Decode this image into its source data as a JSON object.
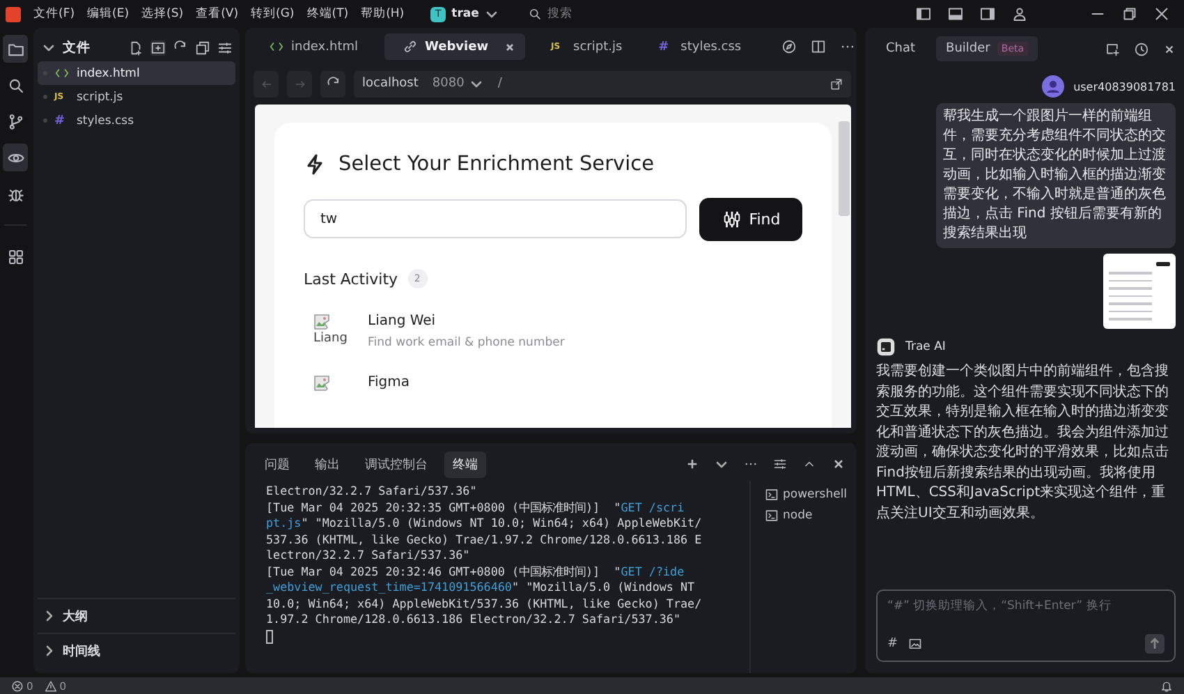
{
  "menu_bar": {
    "menu_items": [
      "文件(F)",
      "编辑(E)",
      "选择(S)",
      "查看(V)",
      "转到(G)",
      "终端(T)",
      "帮助(H)"
    ],
    "project": {
      "initial": "T",
      "name": "trae"
    },
    "search": {
      "placeholder": "搜索"
    }
  },
  "activity_bar": {
    "items": [
      {
        "kind": "files",
        "selected": true
      },
      {
        "kind": "search",
        "selected": false
      },
      {
        "kind": "branch",
        "selected": false
      },
      {
        "kind": "preview",
        "selected": true
      },
      {
        "kind": "bug",
        "selected": false
      },
      {
        "kind": "grid",
        "selected": false
      }
    ]
  },
  "explorer": {
    "title": "文件",
    "expanded": true,
    "files": [
      {
        "name": "index.html",
        "kind": "html",
        "selected": true
      },
      {
        "name": "script.js",
        "kind": "js",
        "icon": "JS",
        "selected": false
      },
      {
        "name": "styles.css",
        "kind": "css",
        "icon": "#",
        "selected": false
      }
    ],
    "sections": [
      {
        "title": "大纲",
        "expanded": false
      },
      {
        "title": "时间线",
        "expanded": false
      }
    ]
  },
  "editor": {
    "tabs": [
      {
        "label": "index.html",
        "kind": "html",
        "selected": false,
        "closable": false
      },
      {
        "label": "Webview",
        "kind": "webview",
        "selected": true,
        "closable": true
      },
      {
        "label": "script.js",
        "kind": "js",
        "icon": "JS",
        "selected": false,
        "closable": false
      },
      {
        "label": "styles.css",
        "kind": "css",
        "icon": "#",
        "selected": false,
        "closable": false
      }
    ],
    "address": {
      "host": "localhost",
      "port": "8080",
      "path": "/"
    },
    "webview": {
      "title": "Select Your Enrichment Service",
      "search": {
        "value": "tw"
      },
      "button": "Find",
      "activity": {
        "title": "Last Activity",
        "count": "2",
        "items": [
          {
            "alt": "Liang",
            "name": "Liang Wei",
            "description": "Find work email & phone number"
          },
          {
            "name": "Figma"
          }
        ]
      }
    }
  },
  "panel": {
    "tabs": [
      {
        "label": "问题",
        "selected": false
      },
      {
        "label": "输出",
        "selected": false
      },
      {
        "label": "调试控制台",
        "selected": false
      },
      {
        "label": "终端",
        "selected": true
      }
    ],
    "lines": [
      [
        {
          "kind": "plain",
          "text": "Electron/32.2.7 Safari/537.36\""
        }
      ],
      [
        {
          "kind": "plain",
          "text": "[Tue Mar 04 2025 20:32:35 GMT+0800 (中国标准时间)]  \""
        },
        {
          "kind": "request",
          "text": "GET /scri"
        }
      ],
      [
        {
          "kind": "request",
          "text": "pt.js"
        },
        {
          "kind": "plain",
          "text": "\" \"Mozilla/5.0 (Windows NT 10.0; Win64; x64) AppleWebKit/"
        }
      ],
      [
        {
          "kind": "plain",
          "text": "537.36 (KHTML, like Gecko) Trae/1.97.2 Chrome/128.0.6613.186 E"
        }
      ],
      [
        {
          "kind": "plain",
          "text": "lectron/32.2.7 Safari/537.36\""
        }
      ],
      [
        {
          "kind": "plain",
          "text": "[Tue Mar 04 2025 20:32:46 GMT+0800 (中国标准时间)]  \""
        },
        {
          "kind": "request",
          "text": "GET /?ide"
        }
      ],
      [
        {
          "kind": "request",
          "text": "_webview_request_time=1741091566460"
        },
        {
          "kind": "plain",
          "text": "\" \"Mozilla/5.0 (Windows NT"
        }
      ],
      [
        {
          "kind": "plain",
          "text": "10.0; Win64; x64) AppleWebKit/537.36 (KHTML, like Gecko) Trae/"
        }
      ],
      [
        {
          "kind": "plain",
          "text": "1.97.2 Chrome/128.0.6613.186 Electron/32.2.7 Safari/537.36\""
        }
      ]
    ],
    "terminals": [
      {
        "name": "powershell"
      },
      {
        "name": "node"
      }
    ]
  },
  "chat": {
    "tabs": [
      {
        "label": "Chat",
        "selected": false
      },
      {
        "label": "Builder",
        "badge": "Beta",
        "selected": true
      }
    ],
    "messages": [
      {
        "kind": "user",
        "author": "user40839081781",
        "text": "帮我生成一个跟图片一样的前端组件，需要充分考虑组件不同状态的交互，同时在状态变化的时候加上过渡动画，比如输入时输入框的描边渐变需要变化，不输入时就是普通的灰色描边，点击 Find 按钮后需要有新的搜索结果出现",
        "attachment": true
      },
      {
        "kind": "assistant",
        "author": "Trae AI",
        "text": "我需要创建一个类似图片中的前端组件，包含搜索服务的功能。这个组件需要实现不同状态下的交互效果，特别是输入框在输入时的描边渐变变化和普通状态下的灰色描边。我会为组件添加过渡动画，确保状态变化时的平滑效果，比如点击Find按钮后新搜索结果的出现动画。我将使用HTML、CSS和JavaScript来实现这个组件，重点关注UI交互和动画效果。"
      }
    ],
    "input": {
      "placeholder": "“#” 切换助理输入，“Shift+Enter” 换行",
      "hash_button": "#"
    }
  },
  "status_bar": {
    "errors": "0",
    "warnings": "0"
  }
}
